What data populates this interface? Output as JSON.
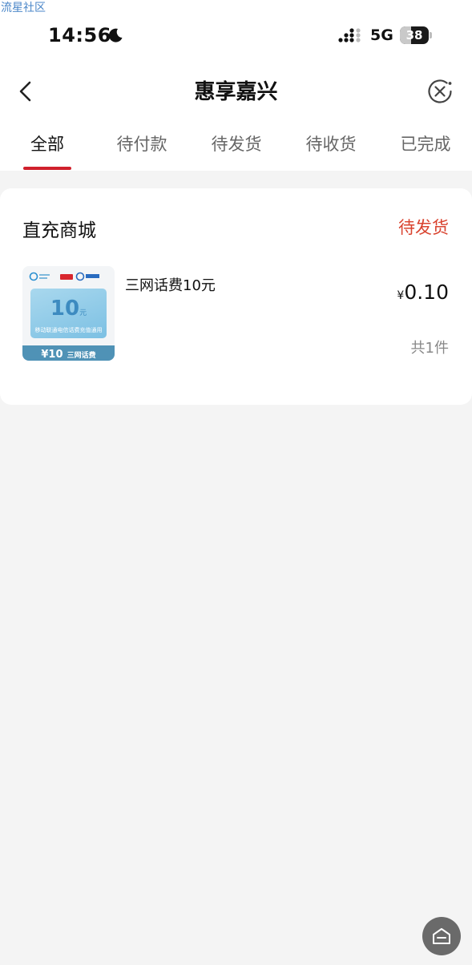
{
  "watermark": "流星社区",
  "status_bar": {
    "time": "14:56",
    "network": "5G",
    "battery": 38,
    "battery_label": "38"
  },
  "nav": {
    "title": "惠享嘉兴"
  },
  "tabs": [
    {
      "label": "全部",
      "active": true
    },
    {
      "label": "待付款",
      "active": false
    },
    {
      "label": "待发货",
      "active": false
    },
    {
      "label": "待收货",
      "active": false
    },
    {
      "label": "已完成",
      "active": false
    }
  ],
  "order": {
    "shop_name": "直充商城",
    "status": "待发货",
    "product_name": "三网话费10元",
    "price_currency": "¥",
    "price": "0.10",
    "quantity": "共1件",
    "thumbnail": {
      "amount": "10",
      "amount_unit": "元",
      "description": "移动联通电信话费充值通用",
      "band_amount": "¥10",
      "band_label": "三网话费"
    }
  },
  "colors": {
    "accent": "#d0202c",
    "status": "#d9432f",
    "background": "#f4f4f4"
  },
  "icons": [
    "moon-icon",
    "signal-icon",
    "back-icon",
    "close-icon",
    "home-icon"
  ]
}
